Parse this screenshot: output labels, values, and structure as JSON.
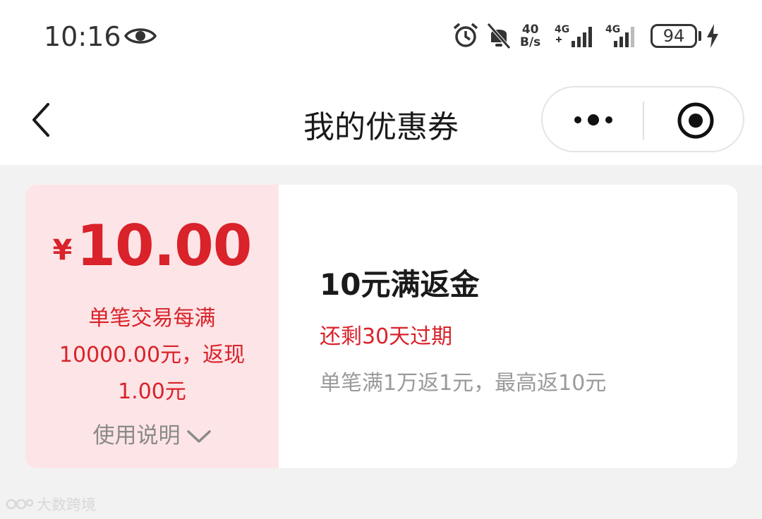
{
  "status_bar": {
    "time": "10:16",
    "net_speed_value": "40",
    "net_speed_unit": "B/s",
    "sim1_label": "4G",
    "sim2_label": "4G",
    "battery": "94",
    "icons": [
      "eye-icon",
      "alarm-icon",
      "bell-off-icon",
      "signal-icon",
      "signal-icon",
      "battery-icon",
      "charging-icon"
    ]
  },
  "nav": {
    "title": "我的优惠券",
    "back_icon": "chevron-left-icon",
    "more_icon": "more-dots-icon",
    "close_icon": "close-miniprogram-icon"
  },
  "coupon": {
    "currency_symbol": "¥",
    "amount": "10.00",
    "rule_lines": [
      "单笔交易每满",
      "10000.00元，返现",
      "1.00元"
    ],
    "usage_label": "使用说明",
    "title": "10元满返金",
    "expire_text": "还剩30天过期",
    "description": "单笔满1万返1元，最高返10元"
  },
  "watermark": {
    "text": "大数跨境"
  },
  "colors": {
    "accent": "#d9222a",
    "coupon_left_bg": "#fde4e6",
    "page_bg": "#f2f2f2"
  }
}
